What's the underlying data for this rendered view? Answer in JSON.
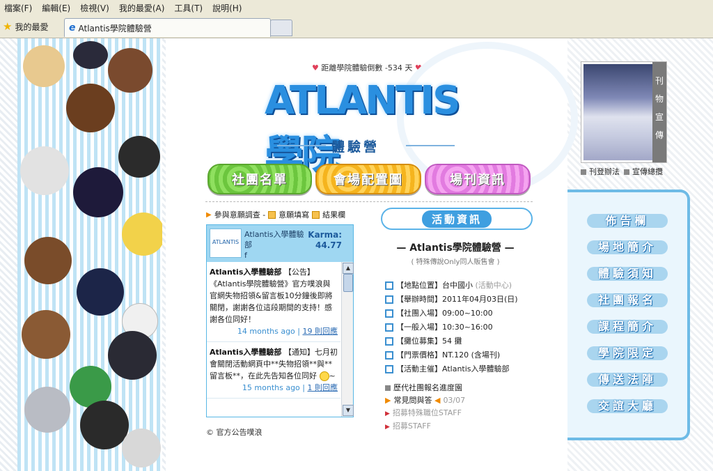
{
  "menubar": [
    "檔案(F)",
    "編輯(E)",
    "檢視(V)",
    "我的最愛(A)",
    "工具(T)",
    "說明(H)"
  ],
  "favorites_label": "我的最愛",
  "tab_title": "Atlantis學院體驗營",
  "countdown": "距離學院體驗倒數 -534 天",
  "logo": {
    "main": "ATLANTIS學院",
    "sub": "體驗營"
  },
  "nav_buttons": [
    "社團名單",
    "會場配置圖",
    "場刊資訊"
  ],
  "small_links": {
    "survey": "參與意願調查 -",
    "fill": "意願填寫",
    "result": "結果欄"
  },
  "plurk": {
    "name": "Atlantis入學體驗部",
    "name_tail": "f",
    "karma_label": "Karma:",
    "karma_value": "44.77",
    "logo_text": "ATLANTIS",
    "posts": [
      {
        "author": "Atlantis入學體驗部",
        "text": "【公告】《Atlantis學院體驗營》官方噗浪與官網失物招領&留言板10分鐘後即將關閉，謝謝各位這段期間的支持！感謝各位同好！",
        "time": "14 months ago",
        "replies": "19 則回應"
      },
      {
        "author": "Atlantis入學體驗部",
        "text": "【通知】七月初會關閉活動網頁中**失物招領**與**留言板**，在此先告知各位同好",
        "tail": "~",
        "time": "15 months ago",
        "replies": "1 則回應"
      }
    ]
  },
  "official_link": "官方公告噗浪",
  "activity": {
    "banner": "活動資訊",
    "title": "— Atlantis學院體驗營 —",
    "subtitle": "( 特殊傳說Only同人販售會 )",
    "rows": [
      {
        "label": "【地點位置】台中國小",
        "extra": "(活動中心)"
      },
      {
        "label": "【舉辦時間】2011年04月03日(日)"
      },
      {
        "label": "【社團入場】09:00~10:00"
      },
      {
        "label": "【一般入場】10:30~16:00"
      },
      {
        "label": "【攤位募集】54 攤"
      },
      {
        "label": "【門票價格】NT.120 (含場刊)"
      },
      {
        "label": "【活動主催】Atlantis入學體驗部"
      }
    ],
    "history": "歷代社團報名進度園",
    "faq": "常見問與答",
    "faq_date": "03/07",
    "recruit1": "招募特殊職位STAFF",
    "recruit2": "招募STAFF"
  },
  "sidebar": {
    "thumb_side": [
      "刊",
      "物",
      "宣",
      "傳"
    ],
    "thumb_links": [
      "刊登辦法",
      "宣傳總攬"
    ],
    "menu": [
      "佈告欄",
      "場地簡介",
      "體驗須知",
      "社團報名",
      "課程簡介",
      "學院限定",
      "傳送法陣",
      "交誼大廳"
    ]
  },
  "colors": {
    "accent": "#3a8fd0",
    "heart": "#e0405a",
    "panel_border": "#6ebbe6"
  }
}
